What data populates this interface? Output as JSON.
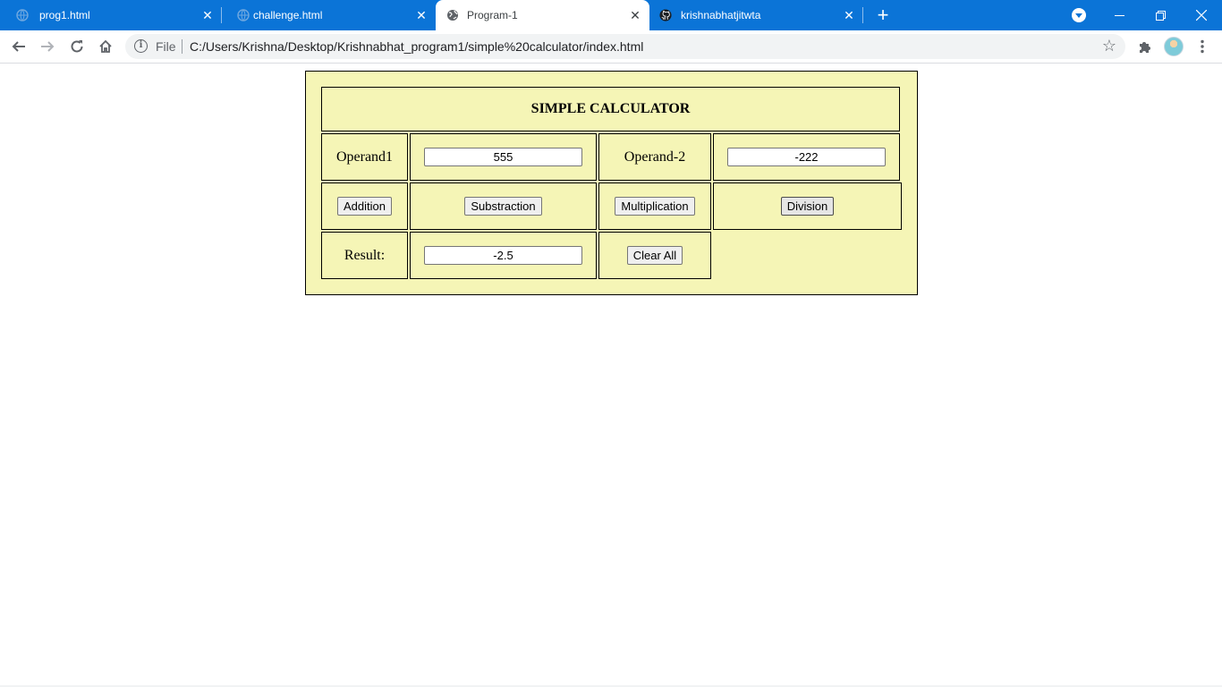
{
  "browser": {
    "tabs": [
      {
        "title": "prog1.html",
        "active": false,
        "icon": "globe-icon"
      },
      {
        "title": "challenge.html",
        "active": false,
        "icon": "globe-icon"
      },
      {
        "title": "Program-1",
        "active": true,
        "icon": "globe-icon"
      },
      {
        "title": "krishnabhatjitwta",
        "active": false,
        "icon": "github-icon"
      }
    ],
    "omnibox": {
      "scheme_label": "File",
      "url": "C:/Users/Krishna/Desktop/Krishnabhat_program1/simple%20calculator/index.html"
    },
    "accent_color": "#0b74d7"
  },
  "calculator": {
    "title": "SIMPLE CALCULATOR",
    "operand1_label": "Operand1",
    "operand1_value": "555",
    "operand2_label": "Operand-2",
    "operand2_value": "-222",
    "buttons": {
      "addition": "Addition",
      "subtraction": "Substraction",
      "multiplication": "Multiplication",
      "division": "Division",
      "clear": "Clear All"
    },
    "result_label": "Result:",
    "result_value": "-2.5",
    "background_color": "#f5f5b6"
  }
}
